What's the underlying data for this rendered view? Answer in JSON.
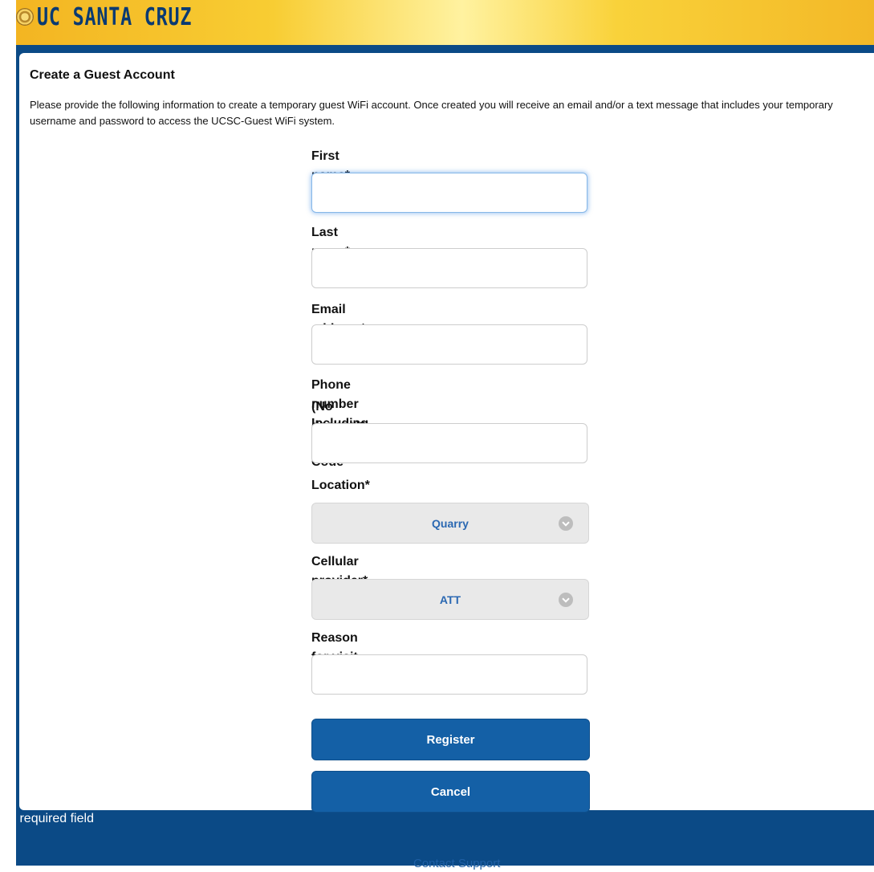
{
  "header": {
    "logo_text": "UC SANTA CRUZ"
  },
  "page": {
    "title": "Create a Guest Account",
    "description": "Please provide the following information to create a temporary guest WiFi account. Once created you will receive an email and/or a text message that includes your temporary username and password to access the UCSC-Guest WiFi system."
  },
  "form": {
    "first_name": {
      "label": "First name*",
      "value": ""
    },
    "last_name": {
      "label": "Last name*",
      "value": ""
    },
    "email": {
      "label": "Email address*",
      "value": ""
    },
    "phone": {
      "label_line1": "Phone number Including Area Code",
      "label_line2": "(No dashes)*",
      "value": ""
    },
    "location": {
      "label": "Location*",
      "value": "Quarry"
    },
    "provider": {
      "label": "Cellular provider*",
      "value": "ATT"
    },
    "reason": {
      "label": "Reason for visit",
      "value": ""
    }
  },
  "buttons": {
    "register": "Register",
    "cancel": "Cancel"
  },
  "footer": {
    "required_note": "* = required field",
    "contact": "Contact Support"
  },
  "colors": {
    "banner_gold": "#f8cd33",
    "frame_blue": "#0b4a86",
    "button_blue": "#1460a6",
    "select_text": "#2a68b2"
  },
  "icons": {
    "select_chevron": "chevron-down-icon",
    "logo": "seal-icon"
  }
}
